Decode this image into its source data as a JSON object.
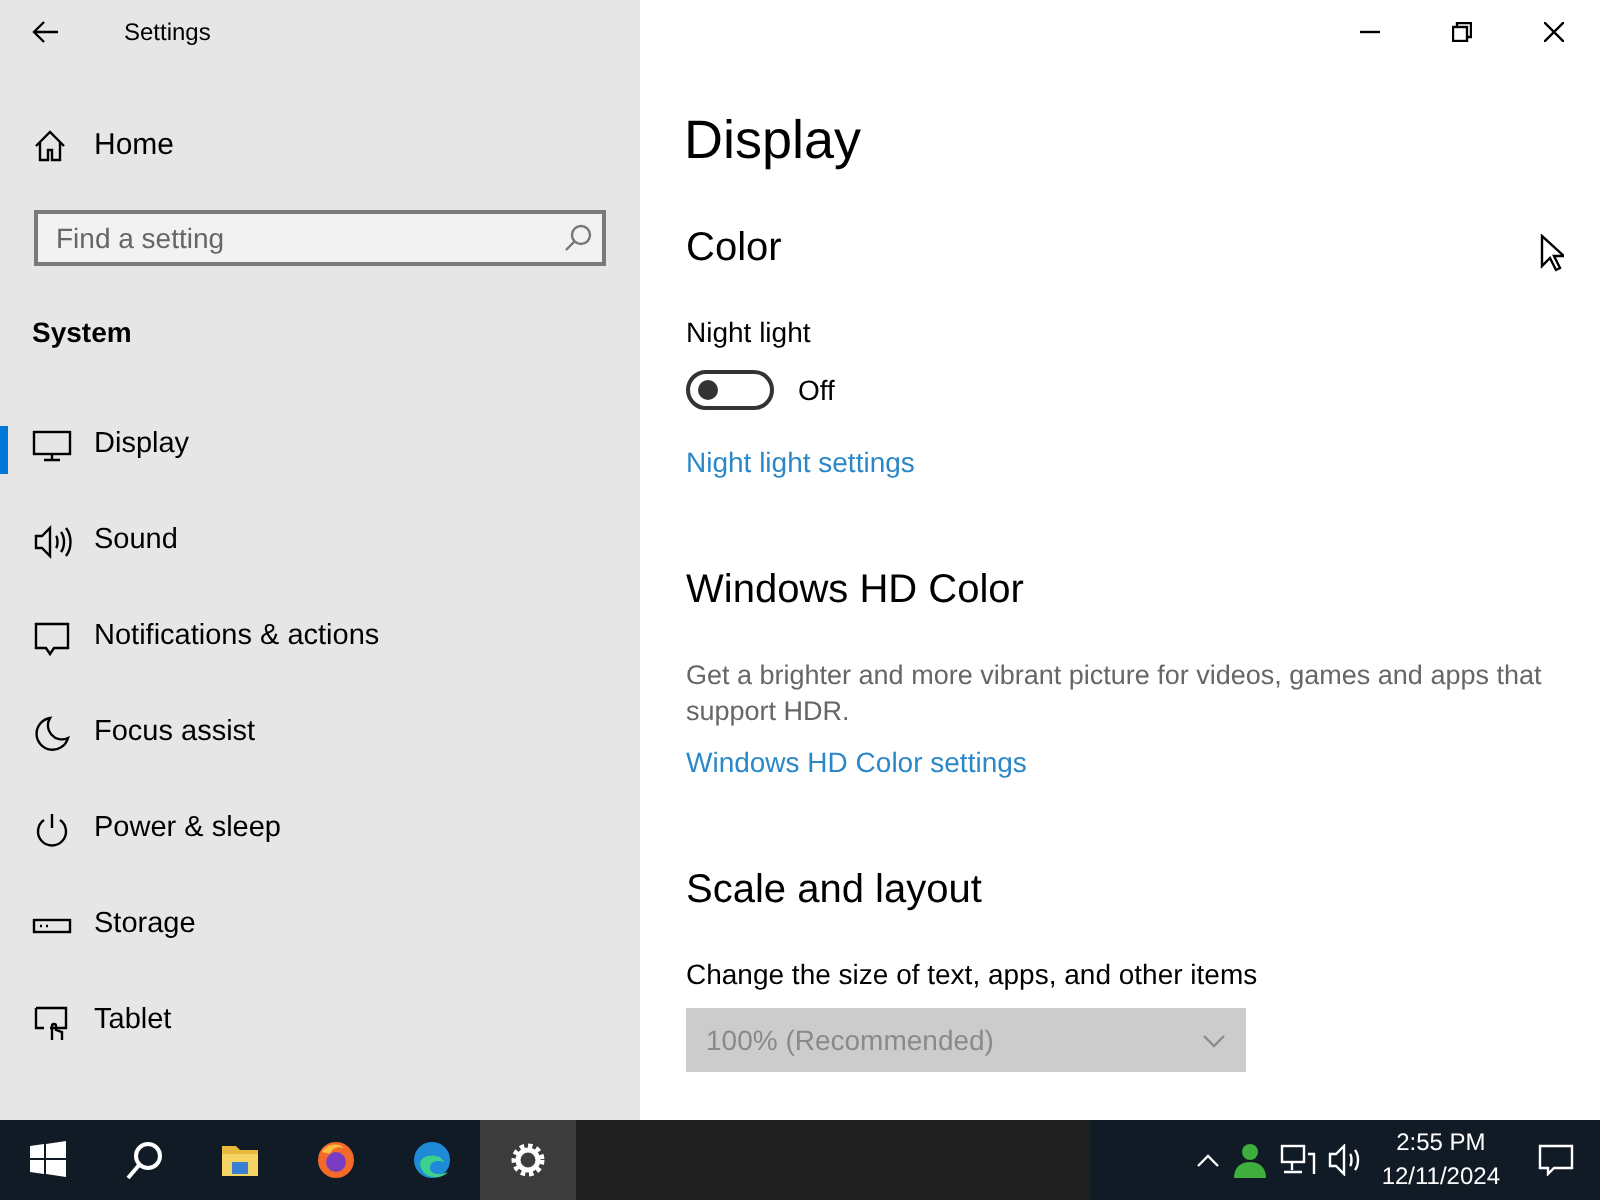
{
  "window": {
    "title": "Settings"
  },
  "sidebar": {
    "home": "Home",
    "search": {
      "placeholder": "Find a setting"
    },
    "section": "System",
    "items": [
      {
        "label": "Display",
        "selected": true
      },
      {
        "label": "Sound",
        "selected": false
      },
      {
        "label": "Notifications & actions",
        "selected": false
      },
      {
        "label": "Focus assist",
        "selected": false
      },
      {
        "label": "Power & sleep",
        "selected": false
      },
      {
        "label": "Storage",
        "selected": false
      },
      {
        "label": "Tablet",
        "selected": false
      }
    ]
  },
  "page": {
    "title": "Display",
    "blocks": [
      {
        "kind": "heading",
        "text": "Color"
      },
      {
        "kind": "label",
        "text": "Night light"
      },
      {
        "kind": "toggle",
        "on": false,
        "state_text": "Off"
      },
      {
        "kind": "link",
        "text": "Night light settings"
      },
      {
        "kind": "heading",
        "text": "Windows HD Color"
      },
      {
        "kind": "text",
        "text": "Get a brighter and more vibrant picture for videos, games and apps that support HDR."
      },
      {
        "kind": "link",
        "text": "Windows HD Color settings"
      },
      {
        "kind": "heading",
        "text": "Scale and layout"
      },
      {
        "kind": "label",
        "text": "Change the size of text, apps, and other items"
      },
      {
        "kind": "dropdown",
        "value": "100% (Recommended)",
        "disabled": true
      }
    ]
  },
  "taskbar": {
    "apps": [
      {
        "kind": "start",
        "selected": false
      },
      {
        "kind": "search",
        "selected": false
      },
      {
        "kind": "explorer",
        "selected": false
      },
      {
        "kind": "firefox",
        "selected": false
      },
      {
        "kind": "edge",
        "selected": false
      },
      {
        "kind": "settings",
        "selected": true
      }
    ],
    "time": "2:55 PM",
    "date": "12/11/2024"
  }
}
